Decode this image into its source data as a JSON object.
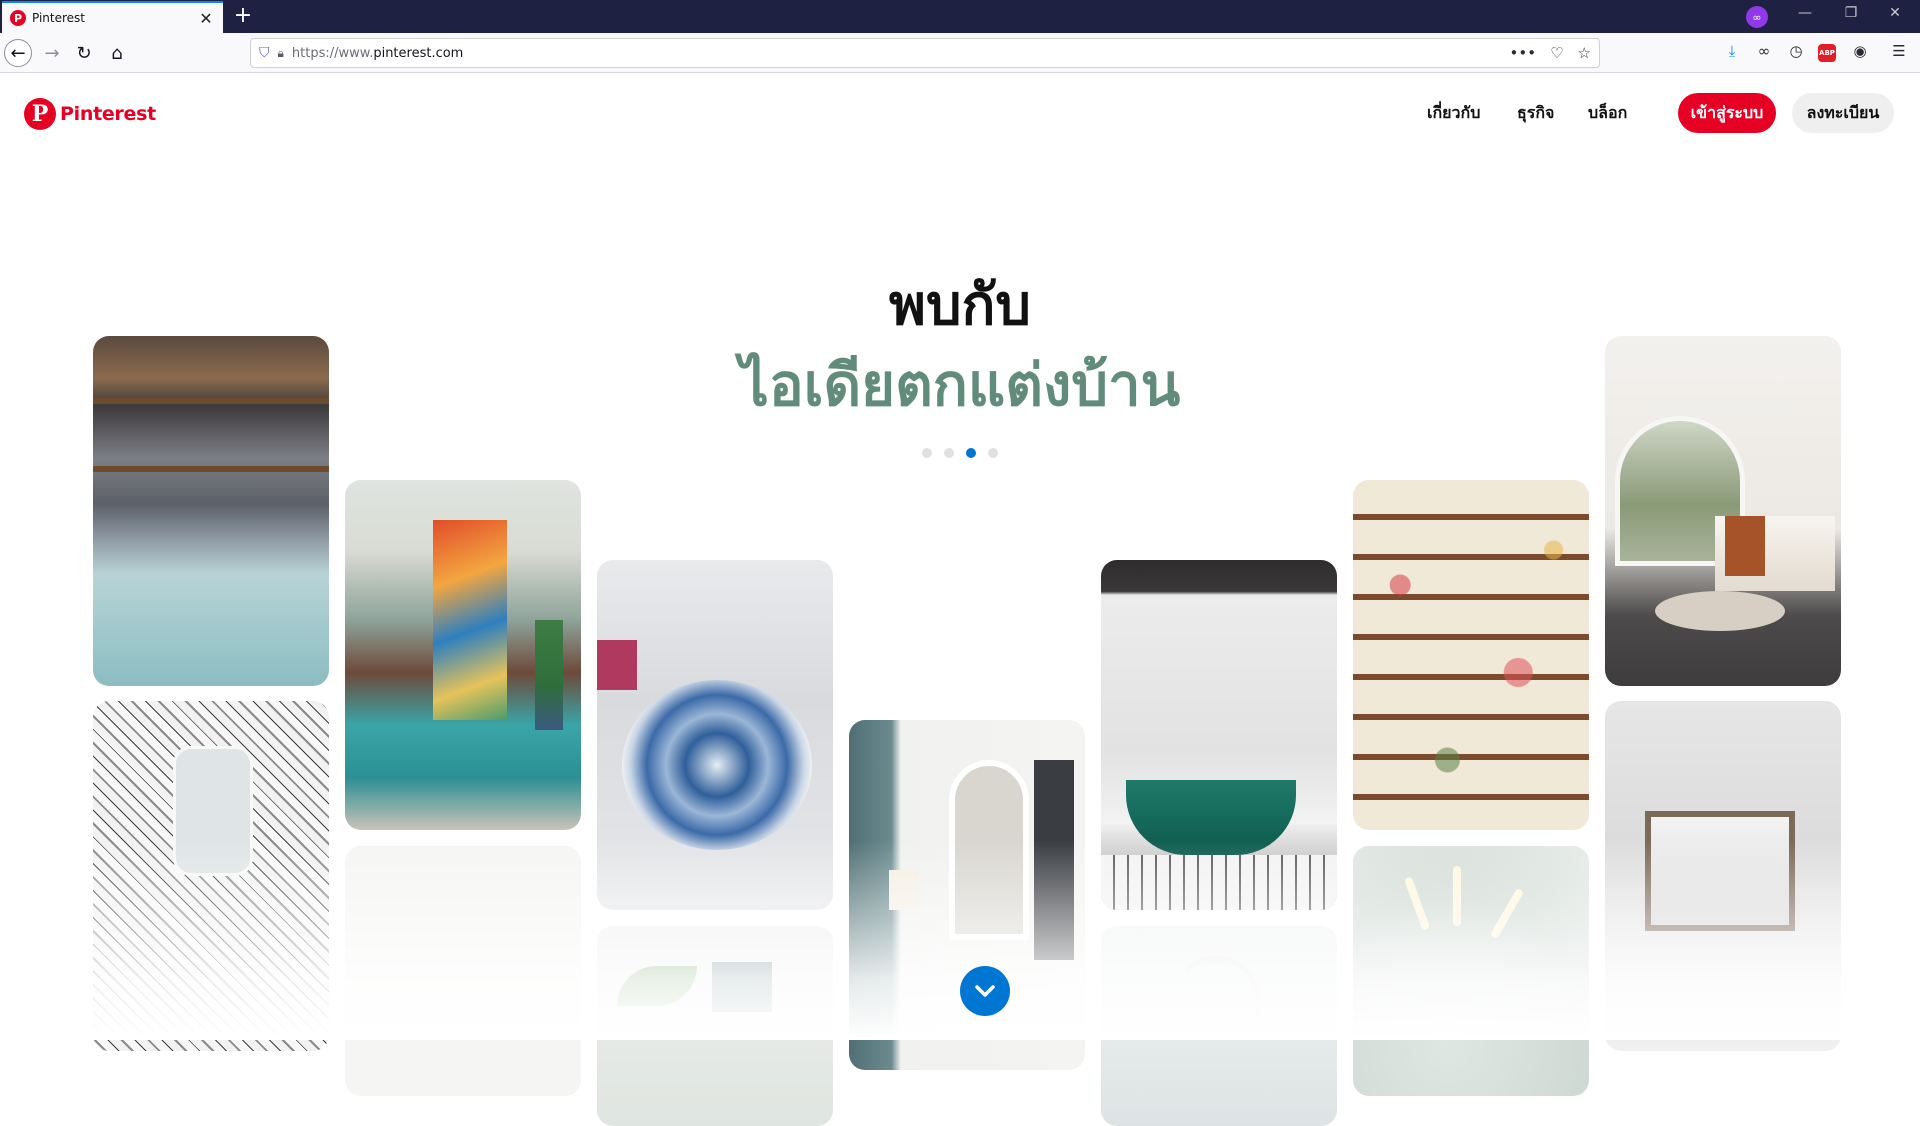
{
  "browser": {
    "tab_title": "Pinterest",
    "tab_favicon": "P",
    "new_tab_label": "+",
    "url_prefix": "https://www.",
    "url_domain": "pinterest.com",
    "abp_label": "ABP",
    "private_mask_label": "∞"
  },
  "header": {
    "logo_text": "Pinterest",
    "logo_mark": "P",
    "nav": [
      "เกี่ยวกับ",
      "ธุรกิจ",
      "บล็อก"
    ],
    "login_label": "เข้าสู่ระบบ",
    "signup_label": "ลงทะเบียน"
  },
  "hero": {
    "title": "พบกับ",
    "subtitle": "ไอเดียตกแต่งบ้าน",
    "carousel_count": 4,
    "carousel_active": 3
  },
  "colors": {
    "brand": "#e60023",
    "subtitle": "#618c7b",
    "accent": "#0076d3"
  },
  "icons": [
    "back-arrow-icon",
    "forward-arrow-icon",
    "reload-icon",
    "home-icon",
    "shield-icon",
    "lock-icon",
    "more-icon",
    "pocket-icon",
    "star-icon",
    "download-icon",
    "glasses-icon",
    "clock-icon",
    "abp-icon",
    "extension-icon",
    "hamburger-menu-icon",
    "chevron-down-icon"
  ]
}
